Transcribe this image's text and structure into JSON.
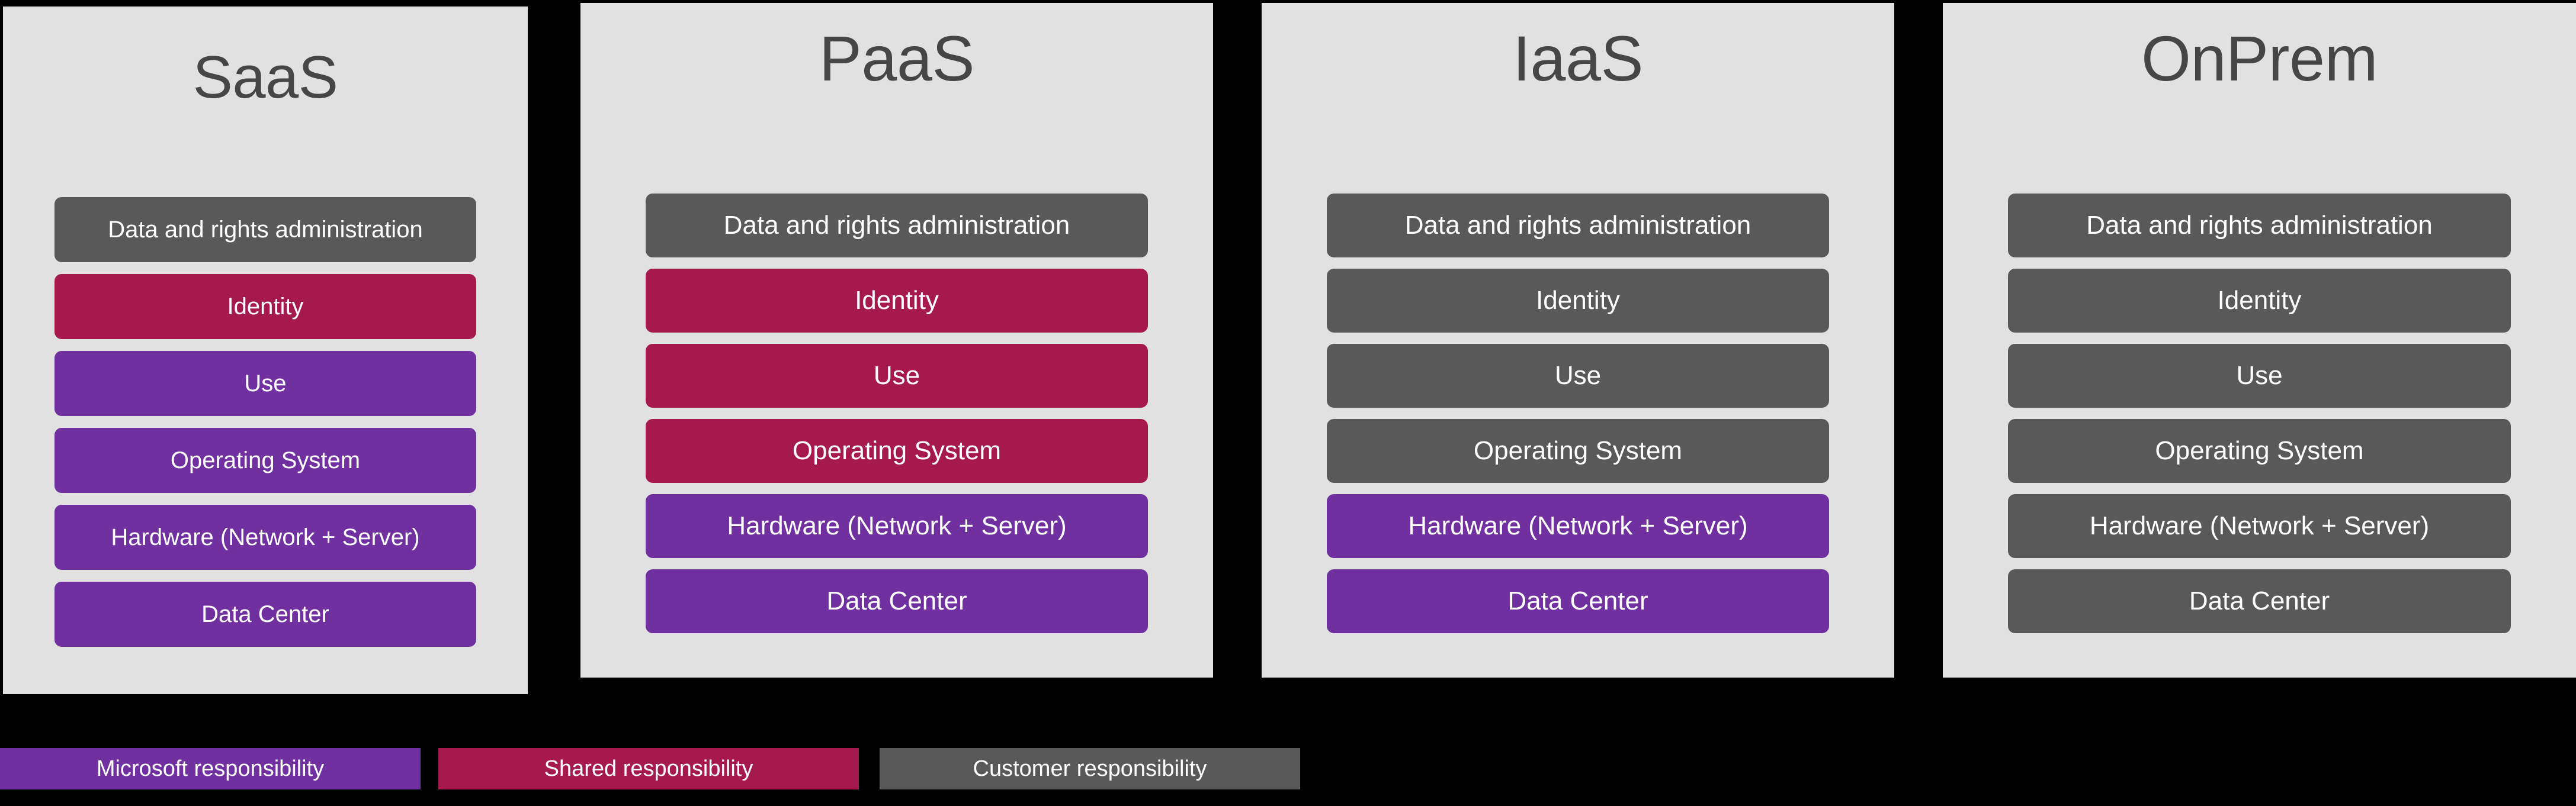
{
  "background_color": "#000000",
  "panel_background_color": "#E1E1E1",
  "title_color": "#464646",
  "colors": {
    "microsoft_responsibility": "#7030A0",
    "shared_responsibility": "#A6194C",
    "customer_responsibility": "#595959"
  },
  "layer_names": [
    "Data and rights administration",
    "Identity",
    "Use",
    "Operating System",
    "Hardware (Network + Server)",
    "Data Center"
  ],
  "columns": [
    {
      "id": "saas",
      "title": "SaaS",
      "layers": [
        {
          "label": "Data and rights administration",
          "responsibility": "Customer responsibility",
          "color": "#595959"
        },
        {
          "label": "Identity",
          "responsibility": "Shared responsibility",
          "color": "#A6194C"
        },
        {
          "label": "Use",
          "responsibility": "Microsoft responsibility",
          "color": "#7030A0"
        },
        {
          "label": "Operating System",
          "responsibility": "Microsoft responsibility",
          "color": "#7030A0"
        },
        {
          "label": "Hardware (Network + Server)",
          "responsibility": "Microsoft responsibility",
          "color": "#7030A0"
        },
        {
          "label": "Data Center",
          "responsibility": "Microsoft responsibility",
          "color": "#7030A0"
        }
      ]
    },
    {
      "id": "paas",
      "title": "PaaS",
      "layers": [
        {
          "label": "Data and rights administration",
          "responsibility": "Customer responsibility",
          "color": "#595959"
        },
        {
          "label": "Identity",
          "responsibility": "Shared responsibility",
          "color": "#A6194C"
        },
        {
          "label": "Use",
          "responsibility": "Shared responsibility",
          "color": "#A6194C"
        },
        {
          "label": "Operating System",
          "responsibility": "Shared responsibility",
          "color": "#A6194C"
        },
        {
          "label": "Hardware (Network + Server)",
          "responsibility": "Microsoft responsibility",
          "color": "#7030A0"
        },
        {
          "label": "Data Center",
          "responsibility": "Microsoft responsibility",
          "color": "#7030A0"
        }
      ]
    },
    {
      "id": "iaas",
      "title": "IaaS",
      "layers": [
        {
          "label": "Data and rights administration",
          "responsibility": "Customer responsibility",
          "color": "#595959"
        },
        {
          "label": "Identity",
          "responsibility": "Customer responsibility",
          "color": "#595959"
        },
        {
          "label": "Use",
          "responsibility": "Customer responsibility",
          "color": "#595959"
        },
        {
          "label": "Operating System",
          "responsibility": "Customer responsibility",
          "color": "#595959"
        },
        {
          "label": "Hardware (Network + Server)",
          "responsibility": "Microsoft responsibility",
          "color": "#7030A0"
        },
        {
          "label": "Data Center",
          "responsibility": "Microsoft responsibility",
          "color": "#7030A0"
        }
      ]
    },
    {
      "id": "onprem",
      "title": "OnPrem",
      "layers": [
        {
          "label": "Data and rights administration",
          "responsibility": "Customer responsibility",
          "color": "#595959"
        },
        {
          "label": "Identity",
          "responsibility": "Customer responsibility",
          "color": "#595959"
        },
        {
          "label": "Use",
          "responsibility": "Customer responsibility",
          "color": "#595959"
        },
        {
          "label": "Operating System",
          "responsibility": "Customer responsibility",
          "color": "#595959"
        },
        {
          "label": "Hardware (Network + Server)",
          "responsibility": "Customer responsibility",
          "color": "#595959"
        },
        {
          "label": "Data Center",
          "responsibility": "Customer responsibility",
          "color": "#595959"
        }
      ]
    }
  ],
  "legend": [
    {
      "label": "Microsoft responsibility",
      "color": "#7030A0"
    },
    {
      "label": "Shared responsibility",
      "color": "#A6194C"
    },
    {
      "label": "Customer responsibility",
      "color": "#595959"
    }
  ]
}
